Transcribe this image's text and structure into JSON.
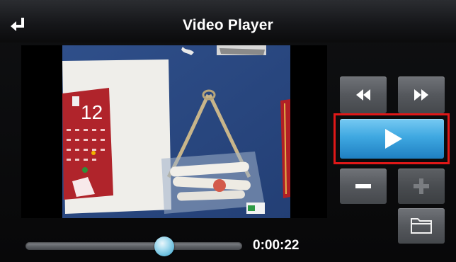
{
  "header": {
    "title": "Video Player",
    "back_icon": "return-arrow-icon"
  },
  "video": {
    "frame_description_icon": "video-frame",
    "calendar_number": "12"
  },
  "controls": {
    "rewind_icon": "rewind-icon",
    "fast_forward_icon": "fast-forward-icon",
    "play_icon": "play-icon",
    "volume_down_icon": "minus-icon",
    "volume_up_icon": "plus-icon",
    "open_folder_icon": "folder-icon",
    "play_highlight_color": "#e01818",
    "play_button_color": "#3fa8e1"
  },
  "playback": {
    "time": "0:00:22",
    "progress": 0.64
  }
}
